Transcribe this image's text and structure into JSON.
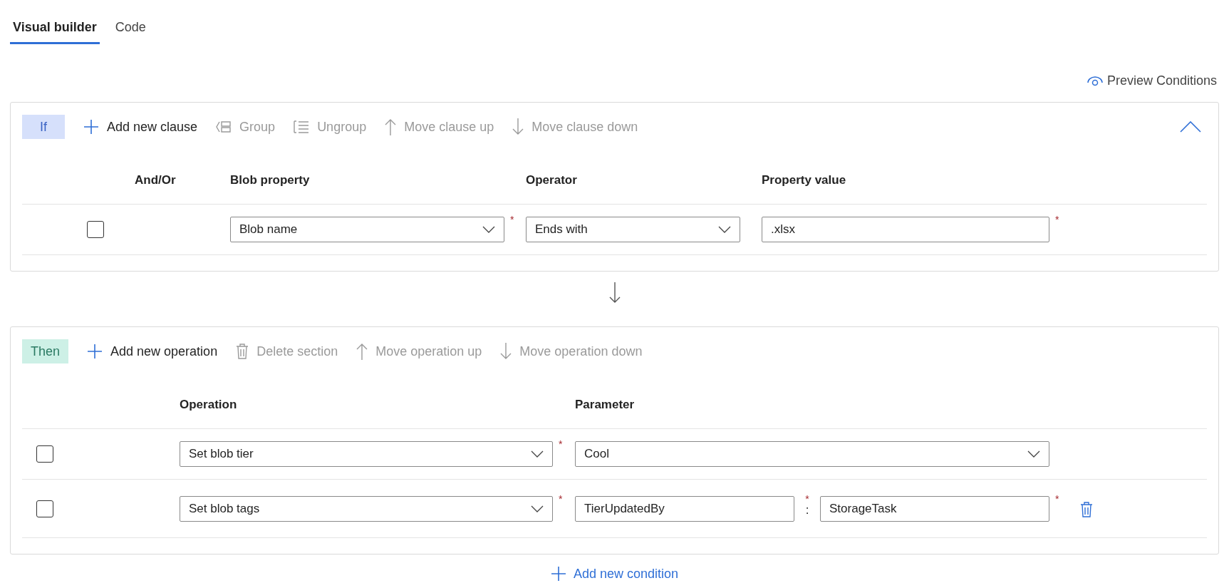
{
  "tabs": [
    {
      "label": "Visual builder",
      "selected": true
    },
    {
      "label": "Code",
      "selected": false
    }
  ],
  "preview_link": "Preview Conditions",
  "if_section": {
    "kind": "if",
    "badge": "If",
    "expanded": true,
    "toolbar": [
      {
        "kind": "add",
        "label": "Add new clause",
        "disabled": false
      },
      {
        "kind": "group",
        "label": "Group",
        "disabled": true
      },
      {
        "kind": "ungroup",
        "label": "Ungroup",
        "disabled": true
      },
      {
        "kind": "up",
        "label": "Move clause up",
        "disabled": true
      },
      {
        "kind": "down",
        "label": "Move clause down",
        "disabled": true
      }
    ],
    "columns": [
      "And/Or",
      "Blob property",
      "Operator",
      "Property value"
    ],
    "clauses": [
      {
        "checked": false,
        "property": {
          "value": "Blob name",
          "mark": "*"
        },
        "operator": {
          "value": "Ends with"
        },
        "value": {
          "value": ".xlsx",
          "mark": "*"
        }
      }
    ]
  },
  "then_section": {
    "kind": "then",
    "badge": "Then",
    "toolbar": [
      {
        "kind": "add",
        "label": "Add new operation",
        "disabled": false
      },
      {
        "kind": "delete",
        "label": "Delete section",
        "disabled": true
      },
      {
        "kind": "up",
        "label": "Move operation up",
        "disabled": true
      },
      {
        "kind": "down",
        "label": "Move operation down",
        "disabled": true
      }
    ],
    "columns": [
      "Operation",
      "Parameter"
    ],
    "operations": [
      {
        "kind": "select",
        "checked": false,
        "operation": {
          "value": "Set blob tier",
          "mark": "*"
        },
        "parameter": {
          "value": "Cool"
        }
      },
      {
        "kind": "tag",
        "checked": false,
        "operation": {
          "value": "Set blob tags",
          "mark": "*"
        },
        "tag_name": {
          "value": "TierUpdatedBy",
          "mark": "*"
        },
        "separator": ":",
        "tag_value": {
          "value": "StorageTask",
          "mark": "*"
        }
      }
    ]
  },
  "add_condition": "Add new condition"
}
